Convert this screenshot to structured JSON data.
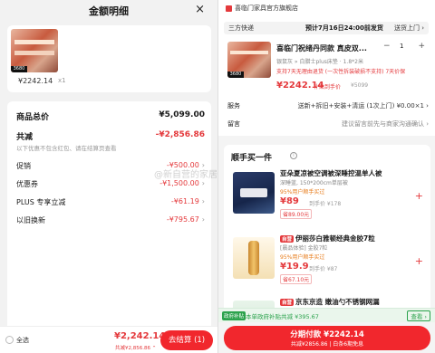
{
  "left": {
    "title": "金额明细",
    "close": "×",
    "product": {
      "thumb_tag": "3680",
      "price": "¥2242.14",
      "qty": "x1"
    },
    "rows": {
      "total_label": "商品总价",
      "total_value": "¥5,099.00",
      "discount_label": "共减",
      "discount_value": "-¥2,856.86",
      "discount_note": "以下优惠不包含红包、请在结算页查看",
      "promo_label": "促销",
      "promo_value": "-¥500.00",
      "coupon_label": "优惠券",
      "coupon_value": "-¥1,500.00",
      "plus_label": "PLUS 专享立减",
      "plus_value": "-¥61.19",
      "tradein_label": "以旧换新",
      "tradein_value": "-¥795.67",
      "chevron": "›"
    },
    "footer": {
      "select_all": "全选",
      "total": "¥2,242.14",
      "total_sub": "共减¥2,856.86 ⌃",
      "checkout": "去结算 (1)"
    }
  },
  "right": {
    "store": "喜临门家具官方旗舰店",
    "shipping": {
      "method": "三方快递",
      "eta": "预计7月16日24:00前发货",
      "install": "送货上门 ›"
    },
    "product": {
      "thumb_tag": "3680",
      "name": "喜临门祝绪丹同款 真皮双...",
      "qty": "1",
      "minus": "−",
      "plus": "+",
      "spec": "银鼠灰 » 白腊士plus床垫 · 1.8*2米",
      "return_note": "支持7天无理由退货 (一次性拆装破损不支持) 7天价保",
      "price": "¥2242.14",
      "price_tag": "补贴到手价",
      "old_price": "¥5099"
    },
    "service": {
      "label": "服务",
      "value": "送新+拆旧+安装+清运 (1次上门) ¥0.00×1 ›"
    },
    "message": {
      "label": "留言",
      "value": "建议留言前先与商家沟通确认 ›"
    },
    "recommend": {
      "title": "顺手买一件",
      "info": "i",
      "items": [
        {
          "name": "亚朵夏凉被空调被深睡控温单人被",
          "spec": "深睡蓝, 150*200cm单层被",
          "good": "95%用户顺手买过",
          "price": "¥89",
          "old": "到手价 ¥178",
          "save": "省89.00元",
          "plus": "+"
        },
        {
          "badge": "自营",
          "name": "伊丽莎白雅顿经典金胶7粒",
          "spec": "[晨品体验] 金胶7粒",
          "good": "95%用户顺手买过",
          "price": "¥19.9",
          "old": "到手价 ¥87",
          "save": "省67.10元",
          "plus": "+"
        },
        {
          "badge": "自营",
          "name": "京东京造 嫩油勺不锈钢网漏"
        }
      ]
    },
    "subsidy": {
      "icon": "政府补贴",
      "text": "本单政府补贴共减 ¥395.67",
      "view": "查看 ›"
    },
    "pay": {
      "line1": "分期付款 ¥2242.14",
      "line2": "共减¥2856.86 | 白条6期免息"
    },
    "watermark": "@新自营的家居"
  }
}
